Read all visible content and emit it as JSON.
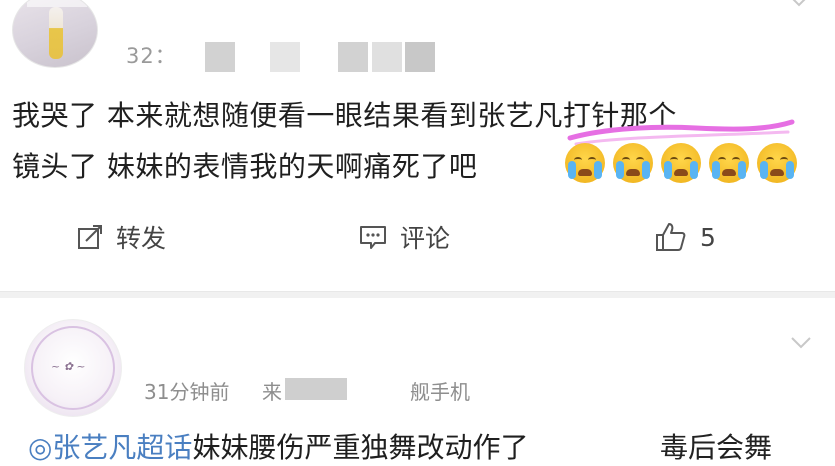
{
  "comment1": {
    "time_prefix": "32",
    "time_sep": "：",
    "line1": "我哭了 本来就想随便看一眼结果看到张艺凡打针那个",
    "line2": "镜头了 妹妹的表情我的天啊痛死了吧",
    "emoji_name": "crying-face",
    "emoji_count": 5,
    "highlight_color": "#e66fe3",
    "actions": {
      "repost_label": "转发",
      "comment_label": "评论",
      "like_count": "5"
    }
  },
  "comment2": {
    "time": "31分钟前",
    "source_prefix": "来",
    "source_suffix": "舰手机",
    "link_text": "◎张艺凡超话",
    "body_text": "妹妹腰伤严重独舞改动作了",
    "trailing_text": "毒后会舞"
  },
  "colors": {
    "link": "#4a7fc1",
    "meta": "#9a9a9a",
    "divider": "#f1f1f1"
  }
}
